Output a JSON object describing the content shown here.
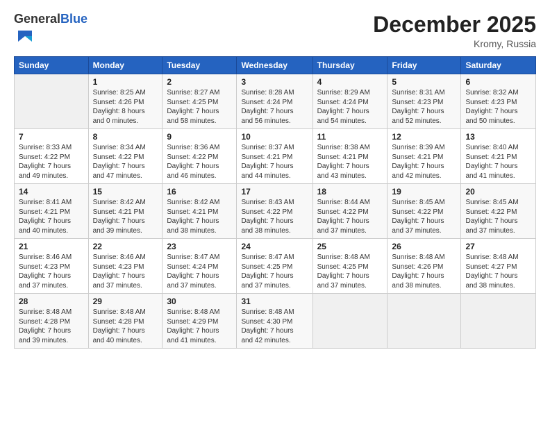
{
  "logo": {
    "general": "General",
    "blue": "Blue"
  },
  "header": {
    "month": "December 2025",
    "location": "Kromy, Russia"
  },
  "days_of_week": [
    "Sunday",
    "Monday",
    "Tuesday",
    "Wednesday",
    "Thursday",
    "Friday",
    "Saturday"
  ],
  "weeks": [
    [
      {
        "day": "",
        "sunrise": "",
        "sunset": "",
        "daylight": ""
      },
      {
        "day": "1",
        "sunrise": "Sunrise: 8:25 AM",
        "sunset": "Sunset: 4:26 PM",
        "daylight": "Daylight: 8 hours and 0 minutes."
      },
      {
        "day": "2",
        "sunrise": "Sunrise: 8:27 AM",
        "sunset": "Sunset: 4:25 PM",
        "daylight": "Daylight: 7 hours and 58 minutes."
      },
      {
        "day": "3",
        "sunrise": "Sunrise: 8:28 AM",
        "sunset": "Sunset: 4:24 PM",
        "daylight": "Daylight: 7 hours and 56 minutes."
      },
      {
        "day": "4",
        "sunrise": "Sunrise: 8:29 AM",
        "sunset": "Sunset: 4:24 PM",
        "daylight": "Daylight: 7 hours and 54 minutes."
      },
      {
        "day": "5",
        "sunrise": "Sunrise: 8:31 AM",
        "sunset": "Sunset: 4:23 PM",
        "daylight": "Daylight: 7 hours and 52 minutes."
      },
      {
        "day": "6",
        "sunrise": "Sunrise: 8:32 AM",
        "sunset": "Sunset: 4:23 PM",
        "daylight": "Daylight: 7 hours and 50 minutes."
      }
    ],
    [
      {
        "day": "7",
        "sunrise": "Sunrise: 8:33 AM",
        "sunset": "Sunset: 4:22 PM",
        "daylight": "Daylight: 7 hours and 49 minutes."
      },
      {
        "day": "8",
        "sunrise": "Sunrise: 8:34 AM",
        "sunset": "Sunset: 4:22 PM",
        "daylight": "Daylight: 7 hours and 47 minutes."
      },
      {
        "day": "9",
        "sunrise": "Sunrise: 8:36 AM",
        "sunset": "Sunset: 4:22 PM",
        "daylight": "Daylight: 7 hours and 46 minutes."
      },
      {
        "day": "10",
        "sunrise": "Sunrise: 8:37 AM",
        "sunset": "Sunset: 4:21 PM",
        "daylight": "Daylight: 7 hours and 44 minutes."
      },
      {
        "day": "11",
        "sunrise": "Sunrise: 8:38 AM",
        "sunset": "Sunset: 4:21 PM",
        "daylight": "Daylight: 7 hours and 43 minutes."
      },
      {
        "day": "12",
        "sunrise": "Sunrise: 8:39 AM",
        "sunset": "Sunset: 4:21 PM",
        "daylight": "Daylight: 7 hours and 42 minutes."
      },
      {
        "day": "13",
        "sunrise": "Sunrise: 8:40 AM",
        "sunset": "Sunset: 4:21 PM",
        "daylight": "Daylight: 7 hours and 41 minutes."
      }
    ],
    [
      {
        "day": "14",
        "sunrise": "Sunrise: 8:41 AM",
        "sunset": "Sunset: 4:21 PM",
        "daylight": "Daylight: 7 hours and 40 minutes."
      },
      {
        "day": "15",
        "sunrise": "Sunrise: 8:42 AM",
        "sunset": "Sunset: 4:21 PM",
        "daylight": "Daylight: 7 hours and 39 minutes."
      },
      {
        "day": "16",
        "sunrise": "Sunrise: 8:42 AM",
        "sunset": "Sunset: 4:21 PM",
        "daylight": "Daylight: 7 hours and 38 minutes."
      },
      {
        "day": "17",
        "sunrise": "Sunrise: 8:43 AM",
        "sunset": "Sunset: 4:22 PM",
        "daylight": "Daylight: 7 hours and 38 minutes."
      },
      {
        "day": "18",
        "sunrise": "Sunrise: 8:44 AM",
        "sunset": "Sunset: 4:22 PM",
        "daylight": "Daylight: 7 hours and 37 minutes."
      },
      {
        "day": "19",
        "sunrise": "Sunrise: 8:45 AM",
        "sunset": "Sunset: 4:22 PM",
        "daylight": "Daylight: 7 hours and 37 minutes."
      },
      {
        "day": "20",
        "sunrise": "Sunrise: 8:45 AM",
        "sunset": "Sunset: 4:22 PM",
        "daylight": "Daylight: 7 hours and 37 minutes."
      }
    ],
    [
      {
        "day": "21",
        "sunrise": "Sunrise: 8:46 AM",
        "sunset": "Sunset: 4:23 PM",
        "daylight": "Daylight: 7 hours and 37 minutes."
      },
      {
        "day": "22",
        "sunrise": "Sunrise: 8:46 AM",
        "sunset": "Sunset: 4:23 PM",
        "daylight": "Daylight: 7 hours and 37 minutes."
      },
      {
        "day": "23",
        "sunrise": "Sunrise: 8:47 AM",
        "sunset": "Sunset: 4:24 PM",
        "daylight": "Daylight: 7 hours and 37 minutes."
      },
      {
        "day": "24",
        "sunrise": "Sunrise: 8:47 AM",
        "sunset": "Sunset: 4:25 PM",
        "daylight": "Daylight: 7 hours and 37 minutes."
      },
      {
        "day": "25",
        "sunrise": "Sunrise: 8:48 AM",
        "sunset": "Sunset: 4:25 PM",
        "daylight": "Daylight: 7 hours and 37 minutes."
      },
      {
        "day": "26",
        "sunrise": "Sunrise: 8:48 AM",
        "sunset": "Sunset: 4:26 PM",
        "daylight": "Daylight: 7 hours and 38 minutes."
      },
      {
        "day": "27",
        "sunrise": "Sunrise: 8:48 AM",
        "sunset": "Sunset: 4:27 PM",
        "daylight": "Daylight: 7 hours and 38 minutes."
      }
    ],
    [
      {
        "day": "28",
        "sunrise": "Sunrise: 8:48 AM",
        "sunset": "Sunset: 4:28 PM",
        "daylight": "Daylight: 7 hours and 39 minutes."
      },
      {
        "day": "29",
        "sunrise": "Sunrise: 8:48 AM",
        "sunset": "Sunset: 4:28 PM",
        "daylight": "Daylight: 7 hours and 40 minutes."
      },
      {
        "day": "30",
        "sunrise": "Sunrise: 8:48 AM",
        "sunset": "Sunset: 4:29 PM",
        "daylight": "Daylight: 7 hours and 41 minutes."
      },
      {
        "day": "31",
        "sunrise": "Sunrise: 8:48 AM",
        "sunset": "Sunset: 4:30 PM",
        "daylight": "Daylight: 7 hours and 42 minutes."
      },
      {
        "day": "",
        "sunrise": "",
        "sunset": "",
        "daylight": ""
      },
      {
        "day": "",
        "sunrise": "",
        "sunset": "",
        "daylight": ""
      },
      {
        "day": "",
        "sunrise": "",
        "sunset": "",
        "daylight": ""
      }
    ]
  ]
}
